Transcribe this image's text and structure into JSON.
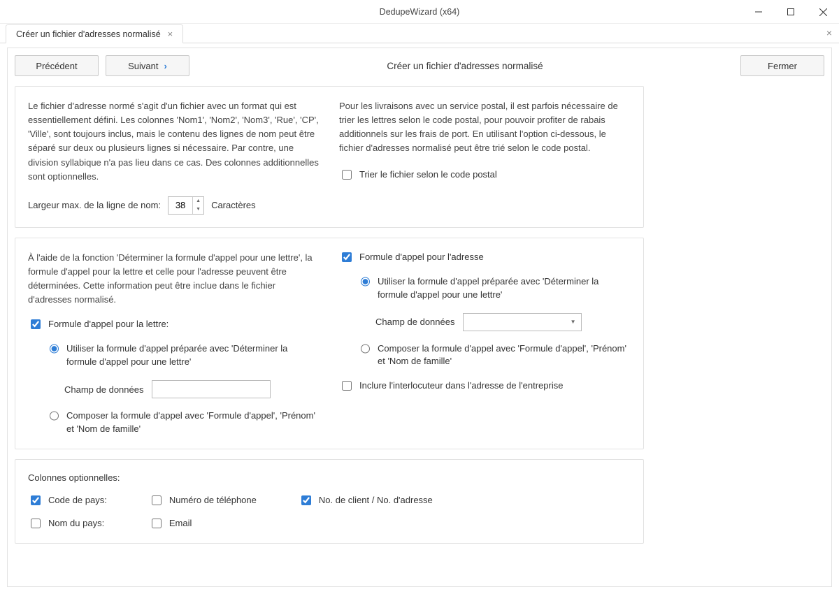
{
  "window": {
    "title": "DedupeWizard  (x64)"
  },
  "tab": {
    "label": "Créer un fichier d'adresses normalisé"
  },
  "toolbar": {
    "prev": "Précédent",
    "next": "Suivant",
    "close": "Fermer"
  },
  "pageTitle": "Créer un fichier d'adresses normalisé",
  "panel1": {
    "leftText": "Le fichier d'adresse normé s'agit d'un fichier avec un format qui est essentiellement défini. Les colonnes 'Nom1', 'Nom2', 'Nom3', 'Rue', 'CP', 'Ville', sont toujours inclus, mais le contenu des lignes de nom peut être séparé sur deux ou plusieurs lignes si nécessaire.  Par contre, une division syllabique n'a pas lieu dans ce cas. Des colonnes additionnelles sont optionnelles.",
    "maxLabel": "Largeur max. de la ligne de nom:",
    "maxValue": "38",
    "maxUnit": "Caractères",
    "rightText": "Pour les livraisons avec un service postal, il est parfois nécessaire de trier les lettres selon le code postal, pour pouvoir profiter de rabais additionnels sur les frais de port. En utilisant l'option ci-dessous, le fichier d'adresses normalisé peut être trié selon le code postal.",
    "sortLabel": "Trier le fichier selon le code postal"
  },
  "panel2": {
    "introText": "À l'aide de la fonction 'Déterminer la formule d'appel pour une lettre', la formule d'appel pour la lettre et celle pour l'adresse peuvent être déterminées. Cette information peut être inclue dans le fichier d'adresses normalisé.",
    "letter": {
      "check": "Formule d'appel pour la lettre:",
      "radio1": "Utiliser la formule d'appel préparée avec 'Déterminer la formule d'appel pour une lettre'",
      "fieldLabel": "Champ de données",
      "fieldValue": "",
      "radio2": "Composer la formule d'appel avec 'Formule d'appel', 'Prénom' et 'Nom de famille'"
    },
    "address": {
      "check": "Formule d'appel pour l'adresse",
      "radio1": "Utiliser la formule d'appel préparée avec 'Déterminer la formule d'appel pour une lettre'",
      "fieldLabel": "Champ de données",
      "comboValue": "",
      "radio2": "Composer la formule d'appel avec 'Formule d'appel', 'Prénom' et 'Nom de famille'",
      "includeContact": "Inclure l'interlocuteur dans l'adresse de l'entreprise"
    }
  },
  "panel3": {
    "title": "Colonnes optionnelles:",
    "col1": {
      "countryCode": "Code de pays:",
      "countryName": "Nom du pays:"
    },
    "col2": {
      "phone": "Numéro de téléphone",
      "email": "Email"
    },
    "col3": {
      "clientNo": "No. de client / No. d'adresse"
    }
  }
}
